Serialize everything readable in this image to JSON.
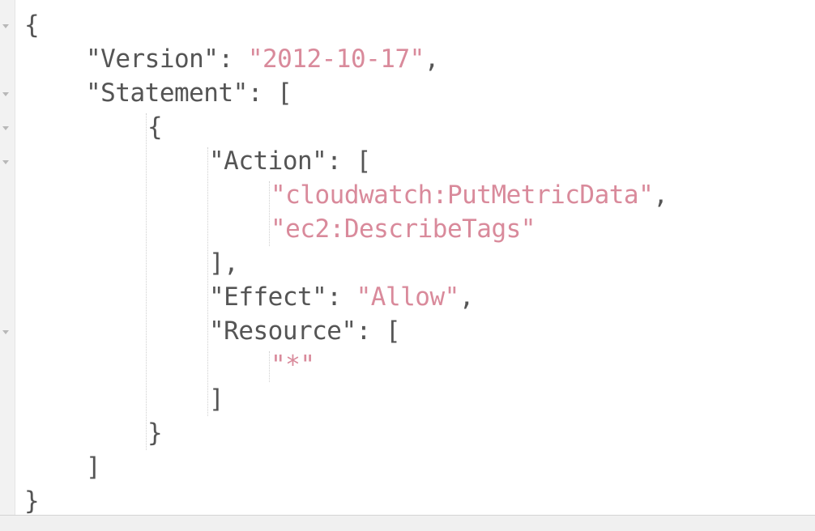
{
  "editor": {
    "lines": [
      {
        "indent": 0,
        "parts": [
          {
            "t": "p",
            "v": "{"
          }
        ]
      },
      {
        "indent": 1,
        "parts": [
          {
            "t": "p",
            "v": "\"Version\": "
          },
          {
            "t": "s",
            "v": "\"2012-10-17\""
          },
          {
            "t": "p",
            "v": ","
          }
        ]
      },
      {
        "indent": 1,
        "parts": [
          {
            "t": "p",
            "v": "\"Statement\": ["
          }
        ]
      },
      {
        "indent": 2,
        "parts": [
          {
            "t": "p",
            "v": "{"
          }
        ]
      },
      {
        "indent": 3,
        "parts": [
          {
            "t": "p",
            "v": "\"Action\": ["
          }
        ]
      },
      {
        "indent": 4,
        "parts": [
          {
            "t": "s",
            "v": "\"cloudwatch:PutMetricData\""
          },
          {
            "t": "p",
            "v": ","
          }
        ]
      },
      {
        "indent": 4,
        "parts": [
          {
            "t": "s",
            "v": "\"ec2:DescribeTags\""
          }
        ]
      },
      {
        "indent": 3,
        "parts": [
          {
            "t": "p",
            "v": "],"
          }
        ]
      },
      {
        "indent": 3,
        "parts": [
          {
            "t": "p",
            "v": "\"Effect\": "
          },
          {
            "t": "s",
            "v": "\"Allow\""
          },
          {
            "t": "p",
            "v": ","
          }
        ]
      },
      {
        "indent": 3,
        "parts": [
          {
            "t": "p",
            "v": "\"Resource\": ["
          }
        ]
      },
      {
        "indent": 4,
        "parts": [
          {
            "t": "s",
            "v": "\"*\""
          }
        ]
      },
      {
        "indent": 3,
        "parts": [
          {
            "t": "p",
            "v": "]"
          }
        ]
      },
      {
        "indent": 2,
        "parts": [
          {
            "t": "p",
            "v": "}"
          }
        ]
      },
      {
        "indent": 1,
        "parts": [
          {
            "t": "p",
            "v": "]"
          }
        ]
      },
      {
        "indent": 0,
        "parts": [
          {
            "t": "p",
            "v": "}"
          }
        ]
      }
    ],
    "fold_markers": [
      0,
      2,
      3,
      4,
      9
    ],
    "colors": {
      "string": "#d98a9b",
      "punctuation": "#555555",
      "gutter": "#f2f2f2"
    }
  }
}
